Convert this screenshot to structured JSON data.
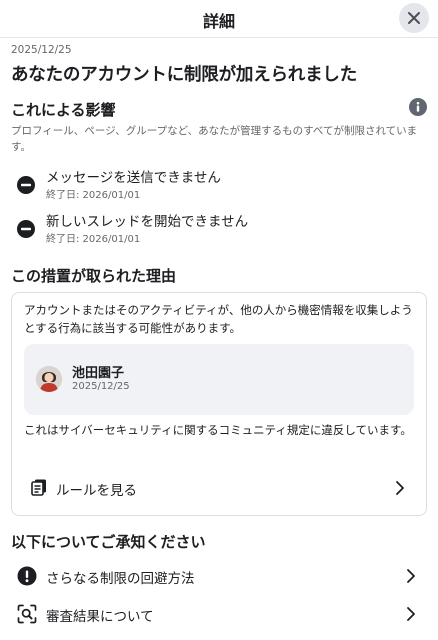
{
  "header": {
    "title": "詳細"
  },
  "notice": {
    "date": "2025/12/25",
    "headline": "あなたのアカウントに制限が加えられました"
  },
  "impact": {
    "title": "これによる影響",
    "description": "プロフィール、ページ、グループなど、あなたが管理するものすべてが制限されています。",
    "restrictions": [
      {
        "label": "メッセージを送信できません",
        "sub": "終了日: 2026/01/01"
      },
      {
        "label": "新しいスレッドを開始できません",
        "sub": "終了日: 2026/01/01"
      }
    ]
  },
  "reason": {
    "title": "この措置が取られた理由",
    "text": "アカウントまたはそのアクティビティが、他の人から機密情報を収集しようとする行為に該当する可能性があります。",
    "reporter": {
      "name": "池田園子",
      "date": "2025/12/25"
    },
    "violation": "これはサイバーセキュリティに関するコミュニティ規定に違反しています。",
    "rules_label": "ルールを見る"
  },
  "acknowledge": {
    "title": "以下についてご承知ください",
    "items": [
      {
        "label": "さらなる制限の回避方法",
        "icon": "exclamation-icon"
      },
      {
        "label": "審査結果について",
        "icon": "review-search-icon"
      }
    ]
  },
  "colors": {
    "text": "#1c1e21",
    "secondary": "#65676b",
    "icon": "#1c1e21",
    "card_bg": "#f0f2f5"
  }
}
